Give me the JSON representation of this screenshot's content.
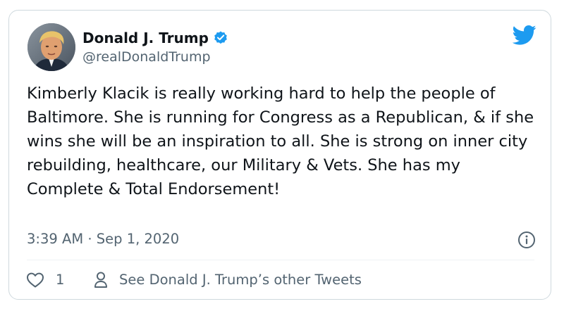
{
  "tweet": {
    "author": {
      "display_name": "Donald J. Trump",
      "handle": "@realDonaldTrump",
      "verified": true
    },
    "text": "Kimberly Klacik is really working hard to help the people of Baltimore. She is running for Congress as a Republican, & if she wins she will be an inspiration to all. She is strong on inner city rebuilding, healthcare, our Military & Vets. She has my Complete & Total Endorsement!",
    "timestamp": "3:39 AM · Sep 1, 2020",
    "like_count": "1",
    "other_tweets_label": "See Donald J. Trump’s other Tweets"
  },
  "icons": {
    "avatar": "avatar",
    "verified": "verified-badge-icon",
    "brand": "twitter-bird-icon",
    "info": "info-icon",
    "like": "heart-icon",
    "profile": "person-icon"
  },
  "colors": {
    "text_primary": "#0f1419",
    "text_secondary": "#536471",
    "brand_blue": "#1d9bf0",
    "border": "#cfd9de"
  }
}
